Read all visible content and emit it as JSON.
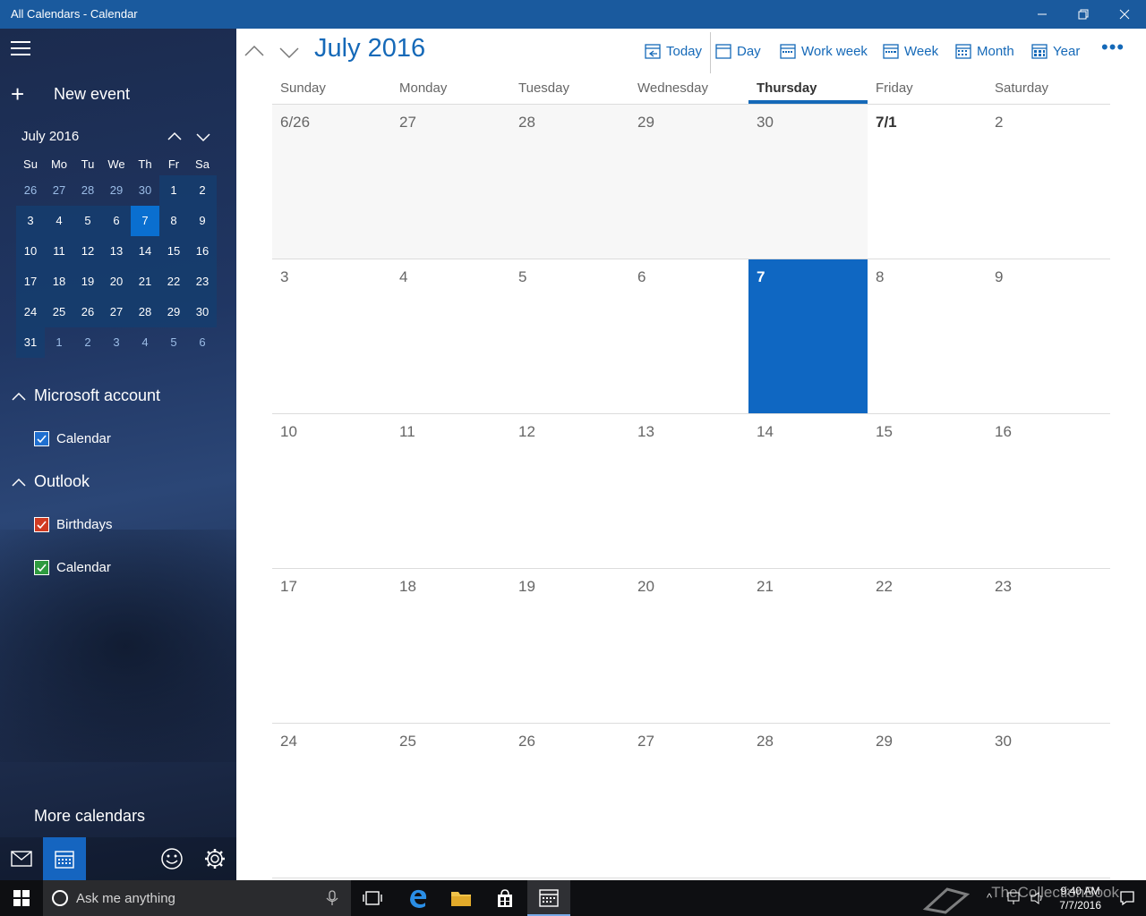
{
  "window": {
    "title": "All Calendars - Calendar"
  },
  "sidebar": {
    "new_event_label": "New event",
    "minical": {
      "month_label": "July 2016",
      "dow": [
        "Su",
        "Mo",
        "Tu",
        "We",
        "Th",
        "Fr",
        "Sa"
      ],
      "weeks": [
        [
          "26",
          "27",
          "28",
          "29",
          "30",
          "1",
          "2"
        ],
        [
          "3",
          "4",
          "5",
          "6",
          "7",
          "8",
          "9"
        ],
        [
          "10",
          "11",
          "12",
          "13",
          "14",
          "15",
          "16"
        ],
        [
          "17",
          "18",
          "19",
          "20",
          "21",
          "22",
          "23"
        ],
        [
          "24",
          "25",
          "26",
          "27",
          "28",
          "29",
          "30"
        ],
        [
          "31",
          "1",
          "2",
          "3",
          "4",
          "5",
          "6"
        ]
      ],
      "today": "7"
    },
    "groups": [
      {
        "label": "Microsoft account",
        "items": [
          {
            "label": "Calendar",
            "color": "#1f6fd0"
          }
        ]
      },
      {
        "label": "Outlook",
        "items": [
          {
            "label": "Birthdays",
            "color": "#d03b22"
          },
          {
            "label": "Calendar",
            "color": "#2e9a3f"
          }
        ]
      }
    ],
    "more_calendars_label": "More calendars"
  },
  "main": {
    "month_title": "July 2016",
    "toolbar": {
      "today": "Today",
      "day": "Day",
      "work_week": "Work week",
      "week": "Week",
      "month": "Month",
      "year": "Year",
      "more": "•••"
    },
    "dow": [
      "Sunday",
      "Monday",
      "Tuesday",
      "Wednesday",
      "Thursday",
      "Friday",
      "Saturday"
    ],
    "current_dow": "Thursday",
    "weeks": [
      [
        "6/26",
        "27",
        "28",
        "29",
        "30",
        "7/1",
        "2"
      ],
      [
        "3",
        "4",
        "5",
        "6",
        "7",
        "8",
        "9"
      ],
      [
        "10",
        "11",
        "12",
        "13",
        "14",
        "15",
        "16"
      ],
      [
        "17",
        "18",
        "19",
        "20",
        "21",
        "22",
        "23"
      ],
      [
        "24",
        "25",
        "26",
        "27",
        "28",
        "29",
        "30"
      ]
    ],
    "today": "7",
    "accent": "#1569b8"
  },
  "taskbar": {
    "search_placeholder": "Ask me anything",
    "time": "9:40 AM",
    "date": "7/7/2016",
    "watermark": "TheCollectionBook"
  }
}
